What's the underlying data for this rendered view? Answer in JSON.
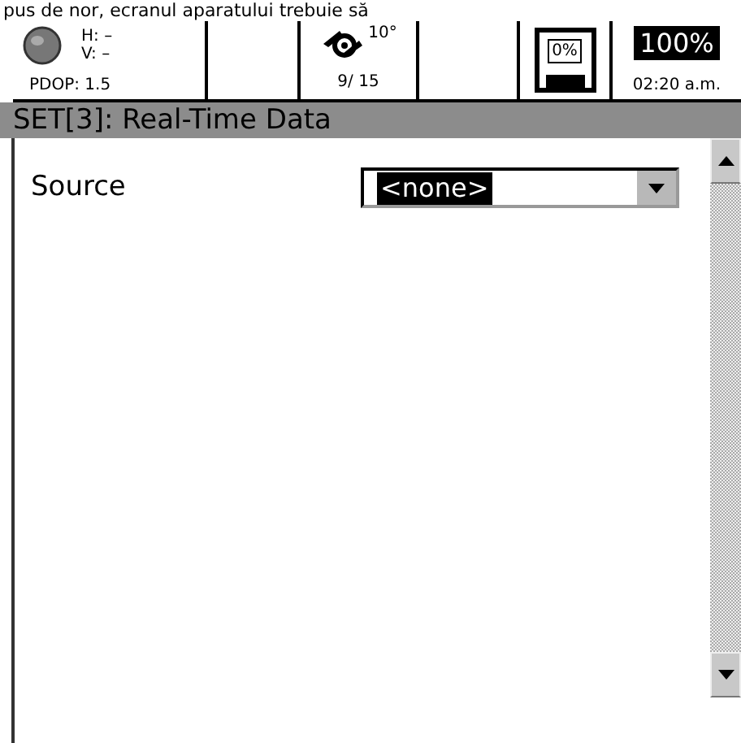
{
  "caption": "pus de nor, ecranul aparatului trebuie să",
  "status_bar": {
    "h": "H: –",
    "v": "V: –",
    "pdop": "PDOP: 1.5",
    "mask": "10°",
    "satellites": "9/ 15",
    "storage": "0%",
    "battery": "100%",
    "time": "02:20 a.m."
  },
  "title": "SET[3]: Real-Time Data",
  "fields": [
    {
      "label": "Source",
      "value": "<none>",
      "selected": true
    }
  ]
}
